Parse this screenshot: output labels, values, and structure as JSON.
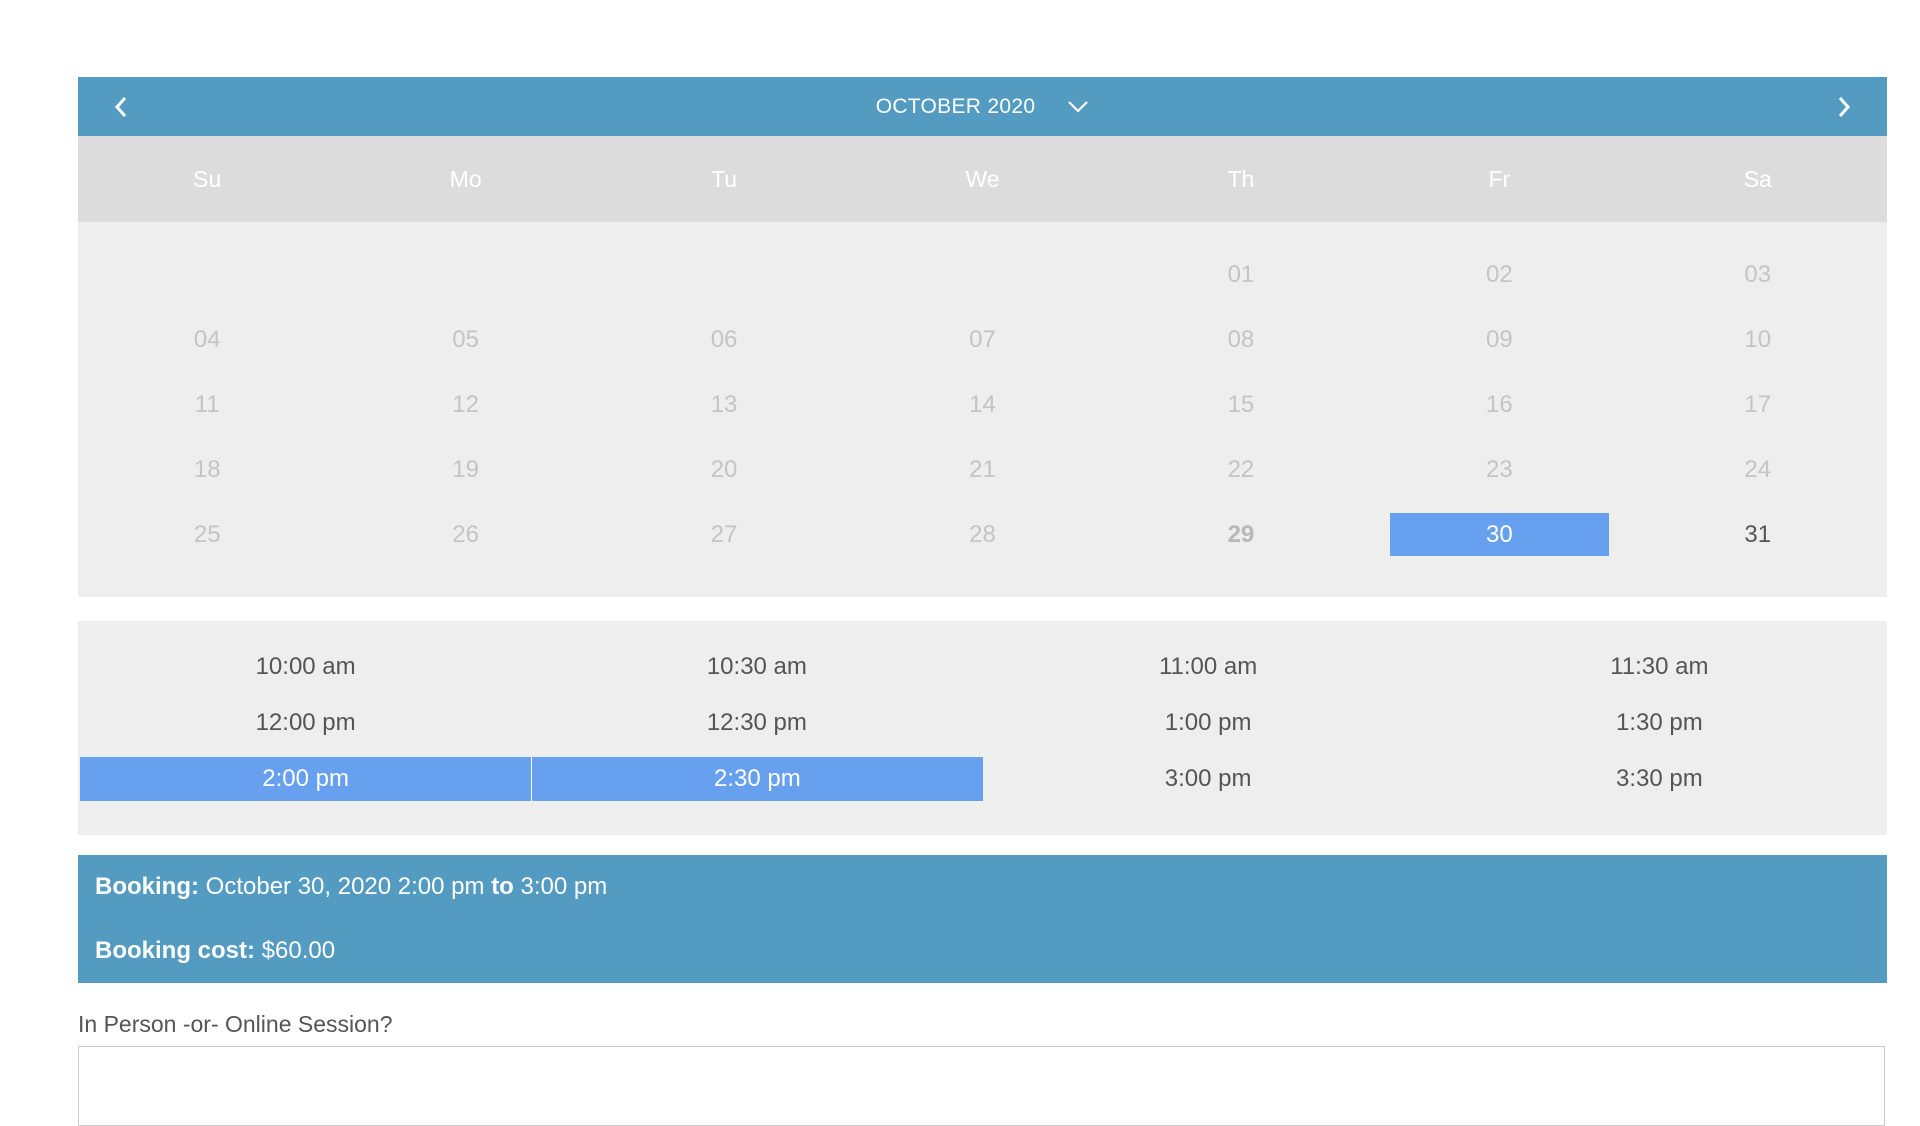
{
  "calendar": {
    "month_label": "OCTOBER 2020",
    "weekdays": [
      "Su",
      "Mo",
      "Tu",
      "We",
      "Th",
      "Fr",
      "Sa"
    ],
    "leading_blanks": 4,
    "days": [
      {
        "label": "01",
        "state": "disabled"
      },
      {
        "label": "02",
        "state": "disabled"
      },
      {
        "label": "03",
        "state": "disabled"
      },
      {
        "label": "04",
        "state": "disabled"
      },
      {
        "label": "05",
        "state": "disabled"
      },
      {
        "label": "06",
        "state": "disabled"
      },
      {
        "label": "07",
        "state": "disabled"
      },
      {
        "label": "08",
        "state": "disabled"
      },
      {
        "label": "09",
        "state": "disabled"
      },
      {
        "label": "10",
        "state": "disabled"
      },
      {
        "label": "11",
        "state": "disabled"
      },
      {
        "label": "12",
        "state": "disabled"
      },
      {
        "label": "13",
        "state": "disabled"
      },
      {
        "label": "14",
        "state": "disabled"
      },
      {
        "label": "15",
        "state": "disabled"
      },
      {
        "label": "16",
        "state": "disabled"
      },
      {
        "label": "17",
        "state": "disabled"
      },
      {
        "label": "18",
        "state": "disabled"
      },
      {
        "label": "19",
        "state": "disabled"
      },
      {
        "label": "20",
        "state": "disabled"
      },
      {
        "label": "21",
        "state": "disabled"
      },
      {
        "label": "22",
        "state": "disabled"
      },
      {
        "label": "23",
        "state": "disabled"
      },
      {
        "label": "24",
        "state": "disabled"
      },
      {
        "label": "25",
        "state": "disabled"
      },
      {
        "label": "26",
        "state": "disabled"
      },
      {
        "label": "27",
        "state": "disabled"
      },
      {
        "label": "28",
        "state": "disabled"
      },
      {
        "label": "29",
        "state": "today"
      },
      {
        "label": "30",
        "state": "selected"
      },
      {
        "label": "31",
        "state": "available"
      }
    ]
  },
  "time_slots": [
    {
      "label": "10:00 am",
      "selected": false
    },
    {
      "label": "10:30 am",
      "selected": false
    },
    {
      "label": "11:00 am",
      "selected": false
    },
    {
      "label": "11:30 am",
      "selected": false
    },
    {
      "label": "12:00 pm",
      "selected": false
    },
    {
      "label": "12:30 pm",
      "selected": false
    },
    {
      "label": "1:00 pm",
      "selected": false
    },
    {
      "label": "1:30 pm",
      "selected": false
    },
    {
      "label": "2:00 pm",
      "selected": true
    },
    {
      "label": "2:30 pm",
      "selected": true
    },
    {
      "label": "3:00 pm",
      "selected": false
    },
    {
      "label": "3:30 pm",
      "selected": false
    }
  ],
  "booking": {
    "label": "Booking:",
    "start": "October 30, 2020 2:00 pm",
    "to_label": "to",
    "end": "3:00 pm",
    "cost_label": "Booking cost:",
    "cost": "$60.00"
  },
  "question": {
    "label": "In Person -or- Online Session?",
    "value": ""
  },
  "colors": {
    "header_blue": "#539bc1",
    "selected_blue": "#66a0ef",
    "weekday_bg": "#dcdcdc",
    "panel_bg": "#eeeeee"
  }
}
